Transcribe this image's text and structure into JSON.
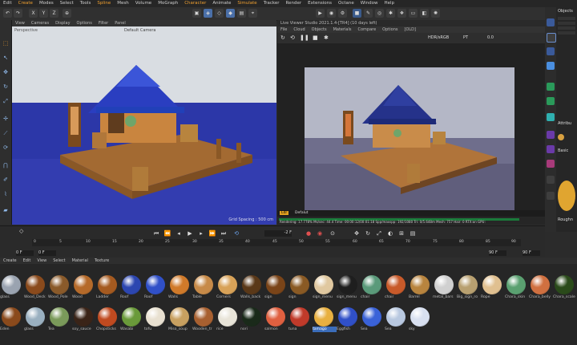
{
  "menu": {
    "items": [
      "Edit",
      "Create",
      "Modes",
      "Select",
      "Tools",
      "Spline",
      "Mesh",
      "Volume",
      "MoGraph",
      "Character",
      "Animate",
      "Simulate",
      "Tracker",
      "Render",
      "Extensions",
      "Octane",
      "Window",
      "Help"
    ],
    "highlight": [
      "Create",
      "Spline",
      "Character",
      "Simulate"
    ]
  },
  "toolbar": {
    "x": "X",
    "y": "Y",
    "z": "Z"
  },
  "viewport": {
    "menu": [
      "View",
      "Cameras",
      "Display",
      "Options",
      "Filter",
      "Panel"
    ],
    "camera_label": "Perspective",
    "camera_name": "Default Camera",
    "grid_spacing": "Grid Spacing : 500 cm"
  },
  "liveviewer": {
    "title": "Live Viewer Studio 2021.1.4-[TR4] (10 days left)",
    "menu": [
      "File",
      "Cloud",
      "Objects",
      "Materials",
      "Compare",
      "Options"
    ],
    "tag": "[OLD]",
    "color_mode": "HDR/sRGB",
    "pt": "PT",
    "exposure": "0.0",
    "badge_left": "Ldr",
    "badge_right": "Defalut",
    "status": "Rendering: 17.778%   Ms/sec: 44.4   Time: 00:00:12/00:01:18   Spp/maxspp: 192/1080   Tri: 0/5.648m   Mesh: 757   Hair: 0   RTX:on   GPU:"
  },
  "timeline": {
    "frame": "-2 F",
    "start": "0 F",
    "end": "90 F",
    "end2": "90 F",
    "frame_right": "0 F",
    "ticks": [
      "0",
      "5",
      "10",
      "15",
      "20",
      "25",
      "30",
      "35",
      "40",
      "45",
      "50",
      "55",
      "60",
      "65",
      "70",
      "75",
      "80",
      "85",
      "90"
    ]
  },
  "materials_menu": [
    "Create",
    "Edit",
    "View",
    "Select",
    "Material",
    "Texture"
  ],
  "materials_row1": [
    "glass",
    "Wood_Deck",
    "Wood_Pole",
    "Wood",
    "Ladder",
    "Roof",
    "Roof",
    "Walls",
    "Table",
    "Corners",
    "Walls_back",
    "sign",
    "sign",
    "sign_menu",
    "sign_menu",
    "chair",
    "chair",
    "Barrel",
    "metal_bars",
    "Big_sign_ro",
    "Rope",
    "Chara_skin",
    "Chara_belly",
    "Chara_scale"
  ],
  "materials_row2": [
    "Eden",
    "glass",
    "Tea",
    "soy_sauce",
    "Chopsticks",
    "Wasabi",
    "tofu",
    "Miso_soup",
    "Wooden_tr",
    "rice",
    "nori",
    "salmon",
    "tuna",
    "tamago",
    "Eggfish",
    "Sea",
    "Sea",
    "sky"
  ],
  "selected_material": "tamago",
  "right_panel": {
    "header": "Objects",
    "attr": "Attribu",
    "basic": "Basic",
    "coord": "Coord",
    "rough": "Roughn"
  }
}
